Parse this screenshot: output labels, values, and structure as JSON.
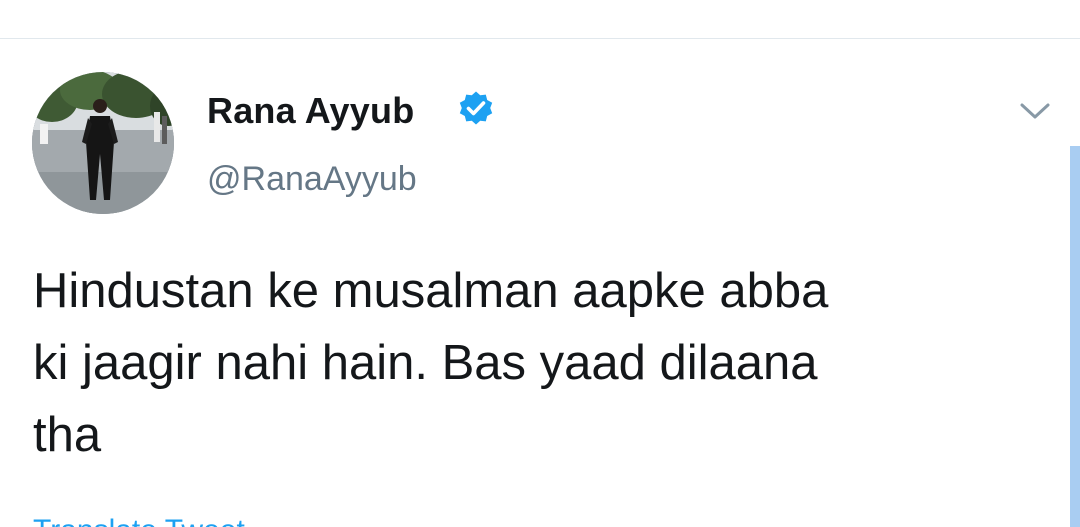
{
  "tweet": {
    "display_name": "Rana Ayyub",
    "handle": "@RanaAyyub",
    "verified": true,
    "text": "Hindustan ke musalman aapke abba\nki jaagir nahi hain. Bas yaad dilaana\ntha",
    "translate_label": "Translate Tweet"
  },
  "icons": {
    "verified": "verified-badge-icon",
    "caret": "chevron-down-icon",
    "avatar": "profile-photo"
  },
  "colors": {
    "accent": "#1da1f2",
    "text": "#14171a",
    "secondary": "#657786",
    "divider": "#e1e8ed"
  }
}
